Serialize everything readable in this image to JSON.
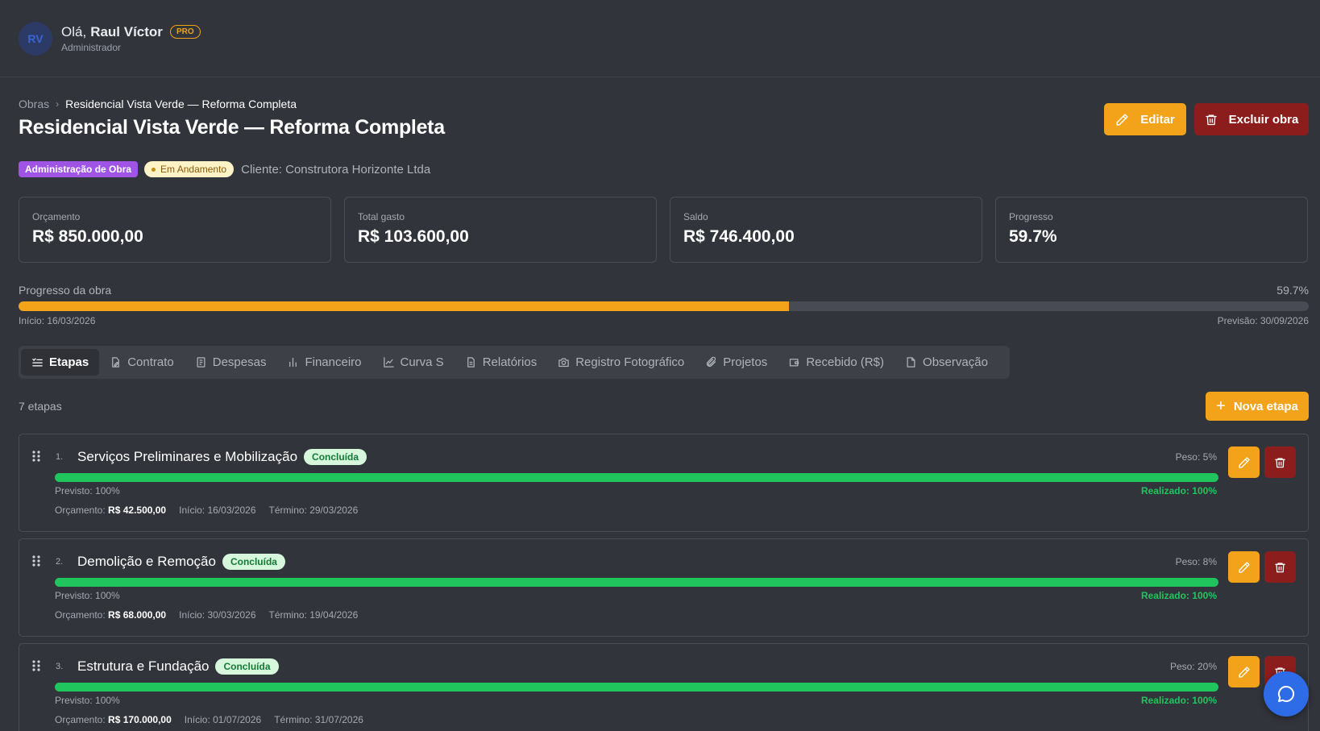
{
  "user": {
    "initials": "RV",
    "greeting": "Olá,",
    "name": "Raul Víctor",
    "badge": "PRO",
    "role": "Administrador"
  },
  "breadcrumb": {
    "root": "Obras",
    "current": "Residencial Vista Verde — Reforma Completa"
  },
  "page": {
    "title": "Residencial Vista Verde — Reforma Completa"
  },
  "actions": {
    "edit_label": "Editar",
    "delete_label": "Excluir obra"
  },
  "tags": {
    "type": "Administração de Obra",
    "status": "Em Andamento",
    "client": "Cliente: Construtora Horizonte Ltda"
  },
  "stats": [
    {
      "label": "Orçamento",
      "value": "R$ 850.000,00"
    },
    {
      "label": "Total gasto",
      "value": "R$ 103.600,00"
    },
    {
      "label": "Saldo",
      "value": "R$ 746.400,00"
    },
    {
      "label": "Progresso",
      "value": "59.7%"
    }
  ],
  "progress": {
    "label": "Progresso da obra",
    "percent_text": "59.7%",
    "percent": 59.7,
    "start": "Início: 16/03/2026",
    "end": "Previsão: 30/09/2026"
  },
  "tabs": [
    {
      "label": "Etapas",
      "icon": "list-icon"
    },
    {
      "label": "Contrato",
      "icon": "file-edit-icon"
    },
    {
      "label": "Despesas",
      "icon": "receipt-icon"
    },
    {
      "label": "Financeiro",
      "icon": "bar-chart-icon"
    },
    {
      "label": "Curva S",
      "icon": "line-chart-icon"
    },
    {
      "label": "Relatórios",
      "icon": "document-icon"
    },
    {
      "label": "Registro Fotográfico",
      "icon": "camera-icon"
    },
    {
      "label": "Projetos",
      "icon": "paperclip-icon"
    },
    {
      "label": "Recebido (R$)",
      "icon": "wallet-icon"
    },
    {
      "label": "Observação",
      "icon": "note-icon"
    }
  ],
  "stages_header": {
    "count": "7 etapas",
    "new_label": "Nova etapa"
  },
  "stages": [
    {
      "num": "1.",
      "name": "Serviços Preliminares e Mobilização",
      "status": "Concluída",
      "peso": "Peso: 5%",
      "progress": 100,
      "previsto": "Previsto: 100%",
      "realizado": "Realizado: 100%",
      "orc_label": "Orçamento:",
      "orc_value": "R$ 42.500,00",
      "inicio": "Início: 16/03/2026",
      "termino": "Término: 29/03/2026"
    },
    {
      "num": "2.",
      "name": "Demolição e Remoção",
      "status": "Concluída",
      "peso": "Peso: 8%",
      "progress": 100,
      "previsto": "Previsto: 100%",
      "realizado": "Realizado: 100%",
      "orc_label": "Orçamento:",
      "orc_value": "R$ 68.000,00",
      "inicio": "Início: 30/03/2026",
      "termino": "Término: 19/04/2026"
    },
    {
      "num": "3.",
      "name": "Estrutura e Fundação",
      "status": "Concluída",
      "peso": "Peso: 20%",
      "progress": 100,
      "previsto": "Previsto: 100%",
      "realizado": "Realizado: 100%",
      "orc_label": "Orçamento:",
      "orc_value": "R$ 170.000,00",
      "inicio": "Início: 01/07/2026",
      "termino": "Término: 31/07/2026"
    }
  ],
  "colors": {
    "accent": "#f2a319",
    "danger": "#8c1d1d",
    "success": "#21c55d",
    "background": "#32343b"
  }
}
